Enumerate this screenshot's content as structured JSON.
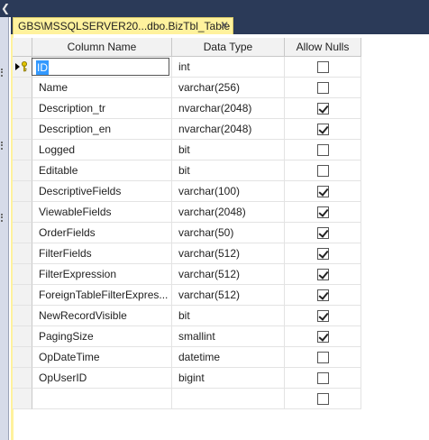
{
  "tab": {
    "title": "GBS\\MSSQLSERVER20...dbo.BizTbl_Table",
    "close": "✕"
  },
  "headers": {
    "column_name": "Column Name",
    "data_type": "Data Type",
    "allow_nulls": "Allow Nulls"
  },
  "rows": [
    {
      "name": "ID",
      "type": "int",
      "nulls": false,
      "key": true,
      "editing": true
    },
    {
      "name": "Name",
      "type": "varchar(256)",
      "nulls": false
    },
    {
      "name": "Description_tr",
      "type": "nvarchar(2048)",
      "nulls": true
    },
    {
      "name": "Description_en",
      "type": "nvarchar(2048)",
      "nulls": true
    },
    {
      "name": "Logged",
      "type": "bit",
      "nulls": false
    },
    {
      "name": "Editable",
      "type": "bit",
      "nulls": false
    },
    {
      "name": "DescriptiveFields",
      "type": "varchar(100)",
      "nulls": true
    },
    {
      "name": "ViewableFields",
      "type": "varchar(2048)",
      "nulls": true
    },
    {
      "name": "OrderFields",
      "type": "varchar(50)",
      "nulls": true
    },
    {
      "name": "FilterFields",
      "type": "varchar(512)",
      "nulls": true
    },
    {
      "name": "FilterExpression",
      "type": "varchar(512)",
      "nulls": true
    },
    {
      "name": "ForeignTableFilterExpres...",
      "type": "varchar(512)",
      "nulls": true
    },
    {
      "name": "NewRecordVisible",
      "type": "bit",
      "nulls": true
    },
    {
      "name": "PagingSize",
      "type": "smallint",
      "nulls": true
    },
    {
      "name": "OpDateTime",
      "type": "datetime",
      "nulls": false
    },
    {
      "name": "OpUserID",
      "type": "bigint",
      "nulls": false
    },
    {
      "name": "",
      "type": "",
      "nulls": false
    }
  ],
  "colors": {
    "tab_accent": "#fff29d",
    "chrome_dark": "#2b3a58",
    "selection": "#3399ff"
  },
  "icons": {
    "primary_key": "key-icon",
    "current_row": "row-pointer-icon",
    "collapse": "chevron-left-icon"
  }
}
